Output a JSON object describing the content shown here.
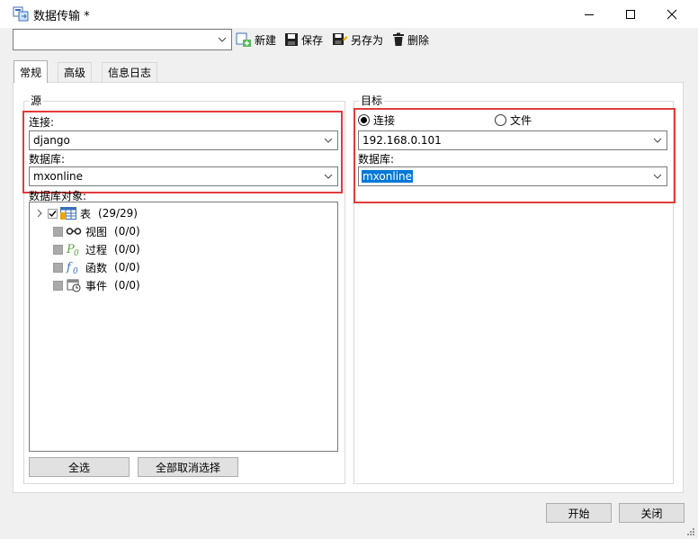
{
  "window": {
    "title": "数据传输 *"
  },
  "toolbar": {
    "combo_value": "",
    "new_label": "新建",
    "save_label": "保存",
    "save_as_label": "另存为",
    "delete_label": "删除"
  },
  "tabs": [
    {
      "label": "常规",
      "active": true
    },
    {
      "label": "高级",
      "active": false
    },
    {
      "label": "信息日志",
      "active": false
    }
  ],
  "source": {
    "title": "源",
    "connection_label": "连接:",
    "connection_value": "django",
    "database_label": "数据库:",
    "database_value": "mxonline",
    "objects_label": "数据库对象:",
    "objects": [
      {
        "name": "表",
        "count": "(29/29)",
        "icon": "table-icon"
      },
      {
        "name": "视图",
        "count": "(0/0)",
        "icon": "view-icon"
      },
      {
        "name": "过程",
        "count": "(0/0)",
        "icon": "procedure-icon"
      },
      {
        "name": "函数",
        "count": "(0/0)",
        "icon": "function-icon"
      },
      {
        "name": "事件",
        "count": "(0/0)",
        "icon": "event-icon"
      }
    ],
    "select_all_label": "全选",
    "deselect_all_label": "全部取消选择"
  },
  "target": {
    "title": "目标",
    "radio_connection_label": "连接",
    "radio_file_label": "文件",
    "connection_value": "192.168.0.101",
    "database_label": "数据库:",
    "database_value": "mxonline"
  },
  "footer": {
    "start_label": "开始",
    "close_label": "关闭"
  },
  "colors": {
    "highlight": "#e13b3b",
    "selection": "#0078d7"
  }
}
